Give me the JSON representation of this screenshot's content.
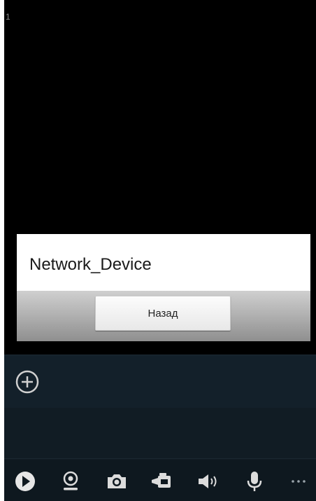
{
  "video": {
    "channel_number": "1"
  },
  "dialog": {
    "title": "Network_Device",
    "back_button_label": "Назад"
  },
  "device_list": {
    "add_icon": "plus-circle-icon"
  },
  "toolbar": {
    "items": [
      {
        "name": "play-icon"
      },
      {
        "name": "webcam-icon"
      },
      {
        "name": "camera-icon"
      },
      {
        "name": "video-record-icon"
      },
      {
        "name": "speaker-icon"
      },
      {
        "name": "microphone-icon"
      },
      {
        "name": "more-icon"
      }
    ]
  },
  "colors": {
    "video_background": "#000000",
    "panel_background": "#111c24",
    "icon_color": "#d9d9d9"
  }
}
